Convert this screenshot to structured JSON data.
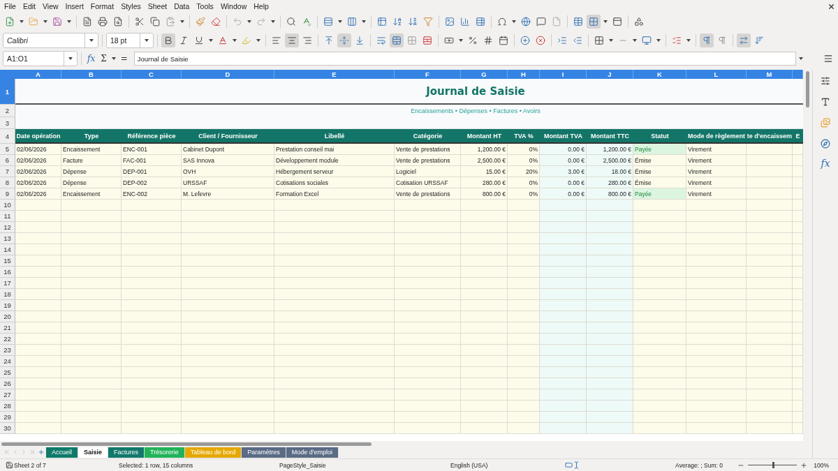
{
  "menu_bar": [
    "File",
    "Edit",
    "View",
    "Insert",
    "Format",
    "Styles",
    "Sheet",
    "Data",
    "Tools",
    "Window",
    "Help"
  ],
  "standard_toolbar": {
    "freeze_rows_columns": true
  },
  "format_toolbar": {
    "font": "Calibri",
    "size": "18 pt",
    "bold": true,
    "italic": false,
    "underline": false,
    "align_left": false,
    "align_center": true,
    "align_right": false,
    "align_top": false,
    "align_middle": true,
    "align_bottom": false,
    "merge_center": true,
    "paragraph_ltr": true,
    "text_horizontal": true
  },
  "formula_bar": {
    "name_box": "A1:O1",
    "function_wizard": "fx",
    "sum": "Σ",
    "equals": "=",
    "content": "Journal de Saisie"
  },
  "sidebar": {
    "functions": "fx"
  },
  "sheet": {
    "column_letters": [
      {
        "label": "A",
        "selected": true
      },
      {
        "label": "B",
        "selected": true
      },
      {
        "label": "C",
        "selected": true
      },
      {
        "label": "D",
        "selected": true
      },
      {
        "label": "E",
        "selected": true
      },
      {
        "label": "F",
        "selected": true
      },
      {
        "label": "G",
        "selected": true
      },
      {
        "label": "H",
        "selected": true
      },
      {
        "label": "I",
        "selected": true
      },
      {
        "label": "J",
        "selected": true
      },
      {
        "label": "K",
        "selected": true
      },
      {
        "label": "L",
        "selected": true
      },
      {
        "label": "M",
        "selected": true
      }
    ],
    "row_numbers": [
      {
        "label": "1",
        "selected": true
      },
      {
        "label": "2",
        "selected": false
      },
      {
        "label": "3",
        "selected": false
      },
      {
        "label": "4",
        "selected": false
      },
      {
        "label": "5",
        "selected": false
      },
      {
        "label": "6",
        "selected": false
      },
      {
        "label": "7",
        "selected": false
      },
      {
        "label": "8",
        "selected": false
      },
      {
        "label": "9",
        "selected": false
      },
      {
        "label": "10",
        "selected": false
      },
      {
        "label": "11",
        "selected": false
      },
      {
        "label": "12",
        "selected": false
      },
      {
        "label": "13",
        "selected": false
      },
      {
        "label": "14",
        "selected": false
      },
      {
        "label": "15",
        "selected": false
      },
      {
        "label": "16",
        "selected": false
      },
      {
        "label": "17",
        "selected": false
      },
      {
        "label": "18",
        "selected": false
      },
      {
        "label": "19",
        "selected": false
      },
      {
        "label": "20",
        "selected": false
      },
      {
        "label": "21",
        "selected": false
      },
      {
        "label": "22",
        "selected": false
      },
      {
        "label": "23",
        "selected": false
      },
      {
        "label": "24",
        "selected": false
      },
      {
        "label": "25",
        "selected": false
      },
      {
        "label": "26",
        "selected": false
      },
      {
        "label": "27",
        "selected": false
      },
      {
        "label": "28",
        "selected": false
      },
      {
        "label": "29",
        "selected": false
      },
      {
        "label": "30",
        "selected": false
      }
    ],
    "title": "Journal de Saisie",
    "subtitle": "Encaissements • Dépenses • Factures • Avoirs",
    "headings": [
      "Date opération",
      "Type",
      "Référence pièce",
      "Client / Fournisseur",
      "Libellé",
      "Catégorie",
      "Montant HT",
      "TVA %",
      "Montant TVA",
      "Montant TTC",
      "Statut",
      "Mode de règlement",
      "te d'encaissem",
      "E"
    ],
    "rows": [
      {
        "cells": [
          "02/06/2026",
          "Encaissement",
          "ENC-001",
          "Cabinet Dupont",
          "Prestation conseil mai",
          "Vente de prestations",
          "1,200.00 €",
          "0%",
          "0.00 €",
          "1,200.00 €"
        ],
        "status": {
          "text": "Payée",
          "kind": "paid"
        },
        "payment": "Virement"
      },
      {
        "cells": [
          "02/06/2026",
          "Facture",
          "FAC-001",
          "SAS Innova",
          "Développement module",
          "Vente de prestations",
          "2,500.00 €",
          "0%",
          "0.00 €",
          "2,500.00 €"
        ],
        "status": {
          "text": "Émise",
          "kind": "issued"
        },
        "payment": "Virement"
      },
      {
        "cells": [
          "02/06/2026",
          "Dépense",
          "DEP-001",
          "OVH",
          "Hébergement serveur",
          "Logiciel",
          "15.00 €",
          "20%",
          "3.00 €",
          "18.00 €"
        ],
        "status": {
          "text": "Émise",
          "kind": "issued"
        },
        "payment": "Virement"
      },
      {
        "cells": [
          "02/06/2026",
          "Dépense",
          "DEP-002",
          "URSSAF",
          "Cotisations sociales",
          "Cotisation URSSAF",
          "280.00 €",
          "0%",
          "0.00 €",
          "280.00 €"
        ],
        "status": {
          "text": "Émise",
          "kind": "issued"
        },
        "payment": "Virement"
      },
      {
        "cells": [
          "02/06/2026",
          "Encaissement",
          "ENC-002",
          "M. Lefevre",
          "Formation Excel",
          "Vente de prestations",
          "800.00 €",
          "0%",
          "0.00 €",
          "800.00 €"
        ],
        "status": {
          "text": "Payée",
          "kind": "paid"
        },
        "payment": "Virement"
      }
    ]
  },
  "sheet_tabs": [
    {
      "label": "Accueil",
      "selected": false,
      "color": "#0f7a6a"
    },
    {
      "label": "Saisie",
      "selected": true
    },
    {
      "label": "Factures",
      "selected": false,
      "color": "#12786b"
    },
    {
      "label": "Trésorerie",
      "selected": false,
      "color": "#22b35a"
    },
    {
      "label": "Tableau de bord",
      "selected": false,
      "color": "#e5a800"
    },
    {
      "label": "Paramètres",
      "selected": false,
      "color": "#5a6b85"
    },
    {
      "label": "Mode d'emploi",
      "selected": false,
      "color": "#5a6b85"
    }
  ],
  "status_bar": {
    "sheet": "Sheet 2 of 7",
    "selection": "Selected: 1 row, 15 columns",
    "page_style": "PageStyle_Saisie",
    "language": "English (USA)",
    "summary": "Average: ; Sum: 0",
    "zoom": {
      "level": 0.5,
      "reading": "100%"
    }
  }
}
